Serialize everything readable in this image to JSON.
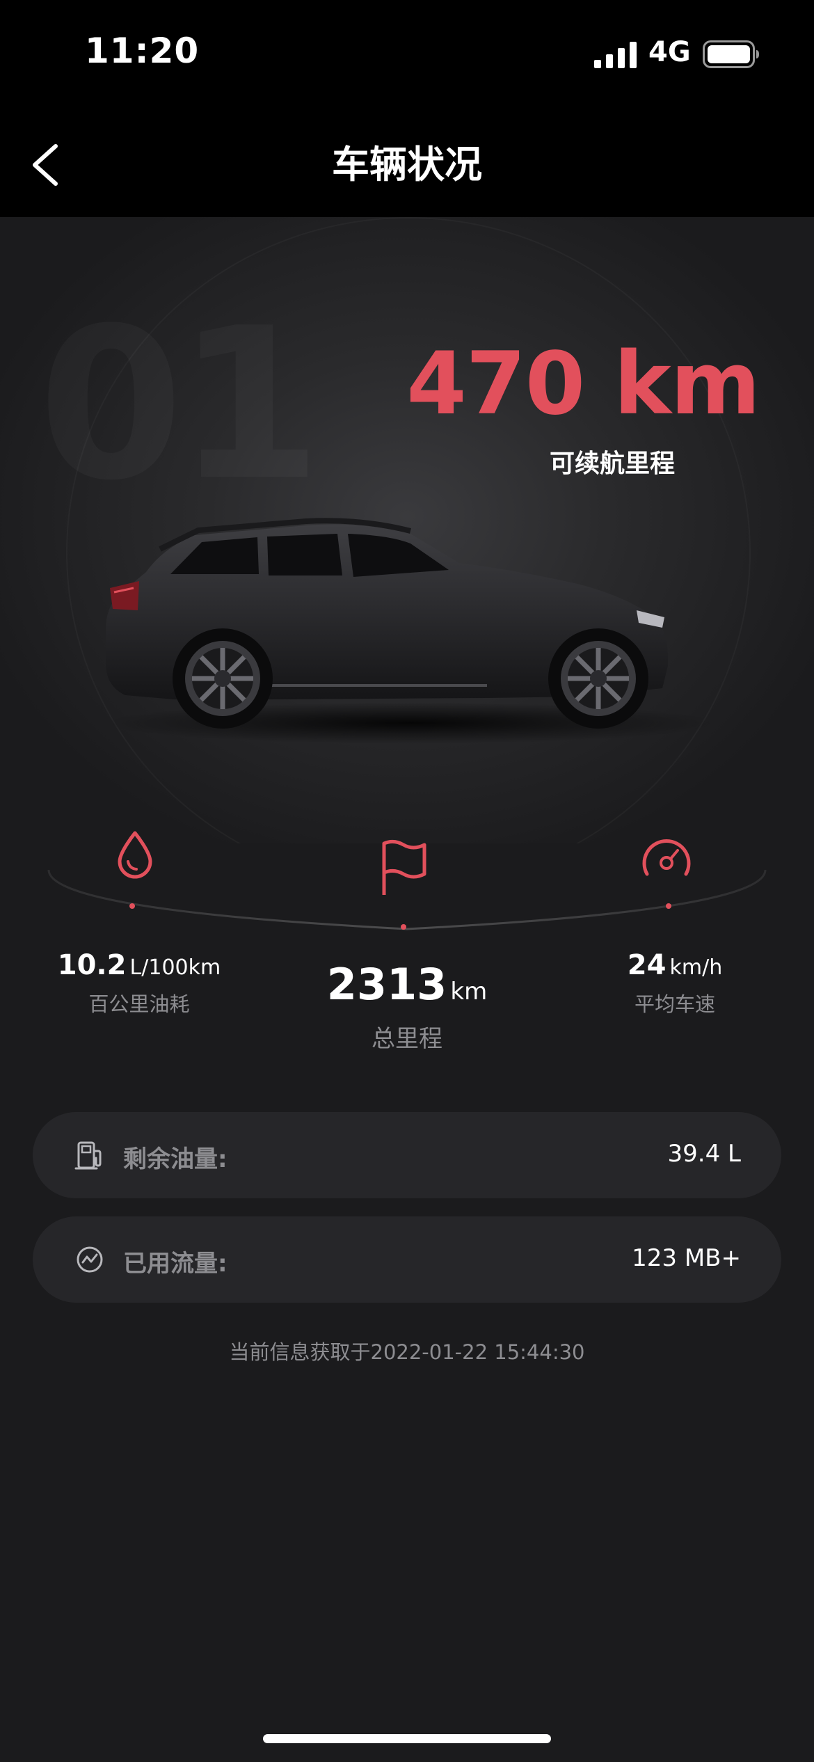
{
  "status_bar": {
    "time": "11:20",
    "network": "4G",
    "icons": [
      "signal-icon",
      "battery-icon"
    ]
  },
  "nav": {
    "title": "车辆状况",
    "back_icon": "chevron-left-icon"
  },
  "hero": {
    "watermark": "01",
    "range_value": "470 km",
    "range_label": "可续航里程"
  },
  "stats": {
    "fuel_consumption": {
      "value": "10.2",
      "unit": "L/100km",
      "label": "百公里油耗",
      "icon": "drop-icon"
    },
    "total_mileage": {
      "value": "2313",
      "unit": "km",
      "label": "总里程",
      "icon": "flag-icon"
    },
    "avg_speed": {
      "value": "24",
      "unit": "km/h",
      "label": "平均车速",
      "icon": "speedometer-icon"
    }
  },
  "cards": {
    "fuel": {
      "label": "剩余油量:",
      "value": "39.4 L",
      "icon": "fuel-pump-icon"
    },
    "data": {
      "label": "已用流量:",
      "value": "123 MB+",
      "icon": "data-usage-icon"
    }
  },
  "update_time": "当前信息获取于2022-01-22 15:44:30",
  "colors": {
    "accent": "#e2505c",
    "background": "#1b1b1d",
    "card": "#262629",
    "muted_text": "#8d8d91"
  }
}
